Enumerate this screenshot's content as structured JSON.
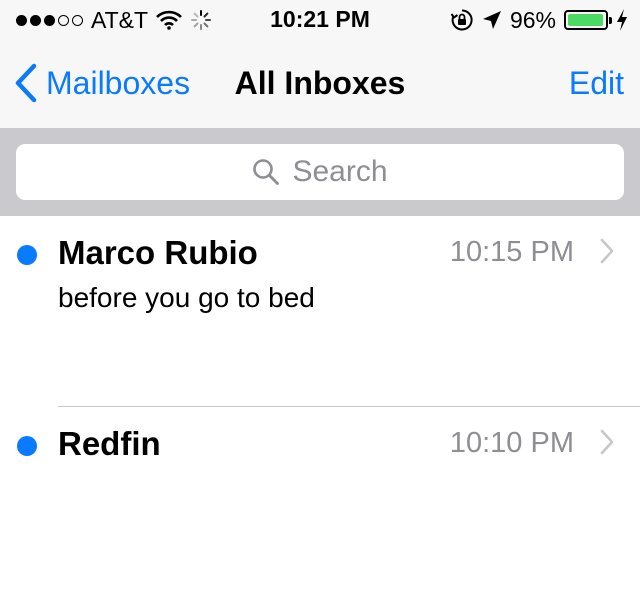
{
  "status_bar": {
    "carrier": "AT&T",
    "time": "10:21 PM",
    "battery_percent": "96%",
    "battery_level": 0.96,
    "signal_bars_filled": 3,
    "signal_bars_total": 5,
    "battery_color": "#4cd964"
  },
  "nav": {
    "back_label": "Mailboxes",
    "title": "All Inboxes",
    "edit_label": "Edit",
    "accent_color": "#0a7aff"
  },
  "search": {
    "placeholder": "Search"
  },
  "messages": [
    {
      "sender": "Marco Rubio",
      "time": "10:15 PM",
      "preview": "before you go to bed",
      "unread": true
    },
    {
      "sender": "Redfin",
      "time": "10:10 PM",
      "preview": "",
      "unread": true
    }
  ],
  "icons": [
    "wifi-icon",
    "activity-spinner-icon",
    "rotation-lock-icon",
    "location-arrow-icon",
    "charging-bolt-icon",
    "back-chevron-icon",
    "search-icon",
    "disclosure-chevron-icon"
  ]
}
